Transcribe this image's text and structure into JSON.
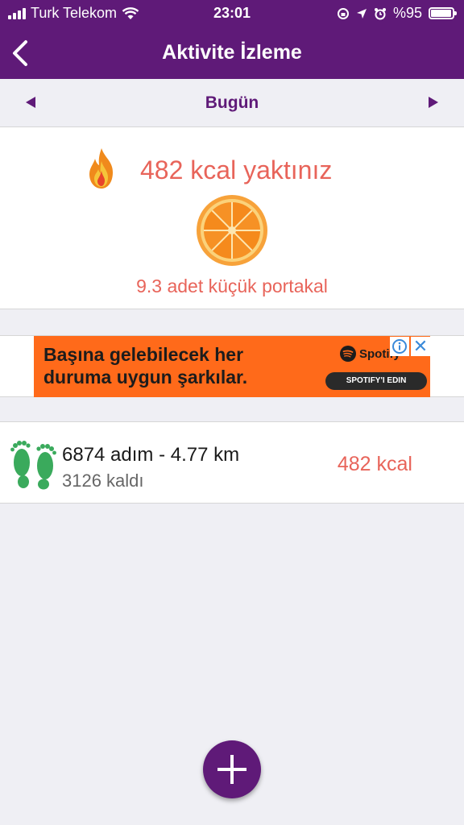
{
  "status_bar": {
    "carrier": "Turk Telekom",
    "time": "23:01",
    "battery": "%95",
    "battery_level": 0.95
  },
  "nav": {
    "title": "Aktivite İzleme"
  },
  "date_selector": {
    "label": "Bugün"
  },
  "burn_summary": {
    "headline": "482 kcal yaktınız",
    "equivalent": "9.3 adet küçük portakal"
  },
  "ad": {
    "line1": "Başına gelebilecek her",
    "line2": "duruma uygun şarkılar.",
    "brand": "Spotify",
    "cta": "SPOTIFY'I EDIN",
    "close": "✕"
  },
  "activity": {
    "steps_summary": "6874 adım - 4.77 km",
    "remaining": "3126 kaldı",
    "kcal": "482 kcal"
  },
  "colors": {
    "primary": "#5f1a78",
    "accent": "#e8645a",
    "feet": "#3aaa5c",
    "ad_bg": "#ff6a1a"
  }
}
